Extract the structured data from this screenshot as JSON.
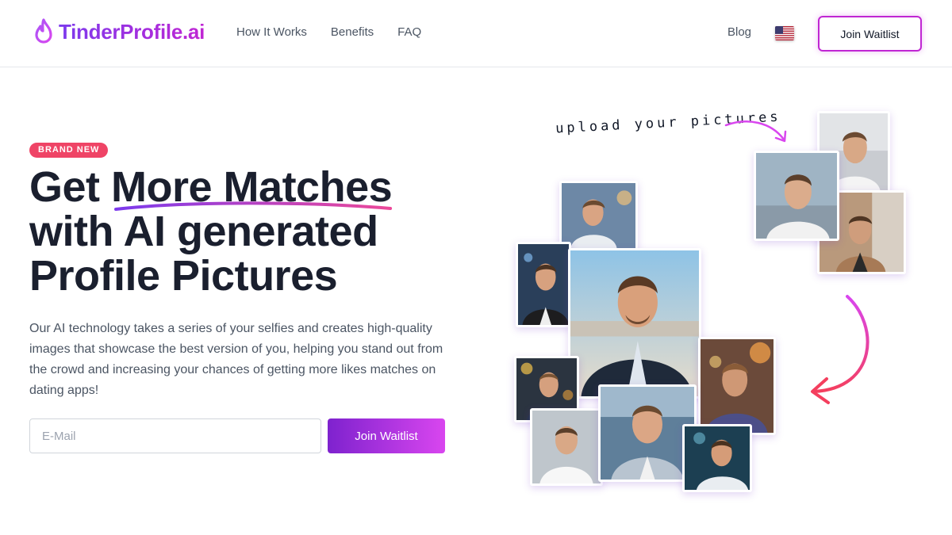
{
  "brand": {
    "name": "TinderProfile.ai",
    "accent": "#a855f7"
  },
  "nav": {
    "items": [
      "How It Works",
      "Benefits",
      "FAQ"
    ],
    "blog": "Blog",
    "cta": "Join Waitlist"
  },
  "hero": {
    "badge": "BRAND NEW",
    "headline_before": "Get ",
    "headline_highlight": "More Matches",
    "headline_after": " with AI generated Profile Pictures",
    "description": "Our AI technology takes a series of your selfies and creates high-quality images that showcase the best version of you, helping you stand out from the crowd and increasing your chances of getting more likes matches on dating apps!",
    "email_placeholder": "E-Mail",
    "cta": "Join Waitlist"
  },
  "illustration": {
    "annotation": "upload your pictures"
  },
  "colors": {
    "gradient_start": "#7e22ce",
    "gradient_end": "#d946ef",
    "badge": "#ef4466",
    "arrow": "#ec4899"
  }
}
